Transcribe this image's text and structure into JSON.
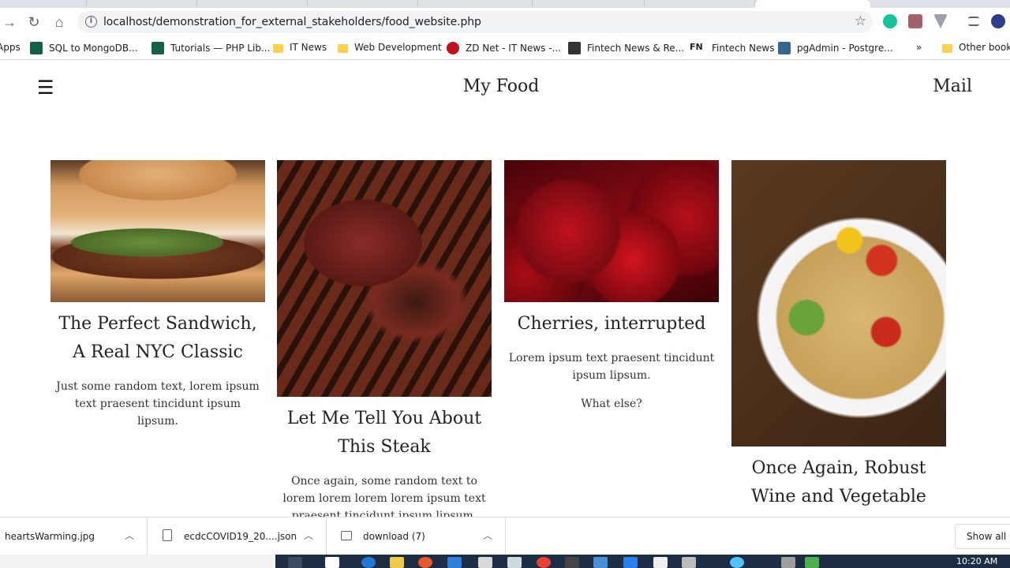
{
  "browser": {
    "url": "localhost/demonstration_for_external_stakeholders/food_website.php",
    "bookmarks": [
      {
        "label": "Apps"
      },
      {
        "label": "SQL to MongoDB..."
      },
      {
        "label": "Tutorials — PHP Lib..."
      },
      {
        "label": "IT News"
      },
      {
        "label": "Web Development"
      },
      {
        "label": "ZD Net - IT News -..."
      },
      {
        "label": "Fintech News & Re..."
      },
      {
        "label": "Fintech News"
      },
      {
        "label": "pgAdmin - Postgre..."
      },
      {
        "label": "»"
      },
      {
        "label": "Other bookm"
      }
    ]
  },
  "site": {
    "menu_icon": "☰",
    "brand": "My Food",
    "mail": "Mail"
  },
  "cards": [
    {
      "title": "The Perfect Sandwich, A Real NYC Classic",
      "text": [
        "Just some random text, lorem ipsum text praesent tincidunt ipsum lipsum."
      ]
    },
    {
      "title": "Let Me Tell You About This Steak",
      "text": [
        "Once again, some random text to lorem lorem lorem lorem ipsum text praesent tincidunt ipsum lipsum."
      ]
    },
    {
      "title": "Cherries, interrupted",
      "text": [
        "Lorem ipsum text praesent tincidunt ipsum lipsum.",
        "What else?"
      ]
    },
    {
      "title": "Once Again, Robust Wine and Vegetable Pasta",
      "text": []
    }
  ],
  "downloads": {
    "items": [
      {
        "name": "heartsWarming.jpg"
      },
      {
        "name": "ecdcCOVID19_20....json"
      },
      {
        "name": "download (7)"
      }
    ],
    "show_all": "Show all"
  },
  "taskbar": {
    "clock": "10:20 AM"
  }
}
